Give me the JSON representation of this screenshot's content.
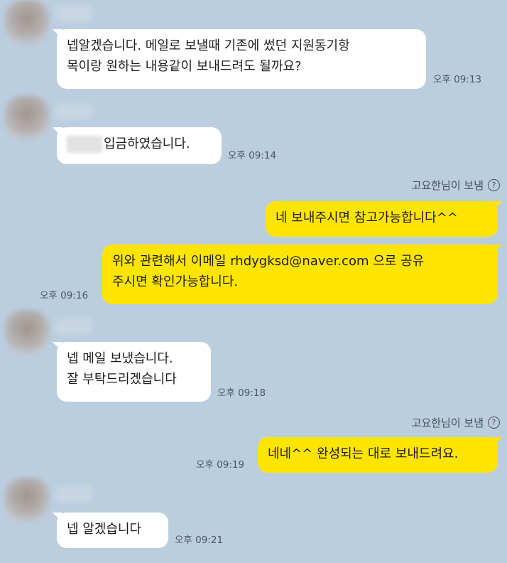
{
  "read_label": "고요한님이 보냄",
  "help_glyph": "?",
  "messages": [
    {
      "lines": [
        "넵알겠습니다. 메일로 보낼때 기존에 썼던 지원동기항",
        "목이랑 원하는 내용같이 보내드려도 될까요?"
      ],
      "time": "오후 09:13"
    },
    {
      "lines": [
        "입금하였습니다."
      ],
      "time": "오후 09:14"
    },
    {
      "lines": [
        "네 보내주시면 참고가능합니다^^"
      ]
    },
    {
      "lines": [
        "위와 관련해서 이메일 rhdygksd@naver.com 으로 공유",
        "주시면 확인가능합니다."
      ],
      "time": "오후 09:16"
    },
    {
      "lines": [
        "넵 메일 보냈습니다.",
        "잘 부탁드리겠습니다"
      ],
      "time": "오후 09:18"
    },
    {
      "lines": [
        "네네^^ 완성되는 대로 보내드려요."
      ],
      "time": "오후 09:19"
    },
    {
      "lines": [
        "넵 알겠습니다"
      ],
      "time": "오후 09:21"
    }
  ]
}
